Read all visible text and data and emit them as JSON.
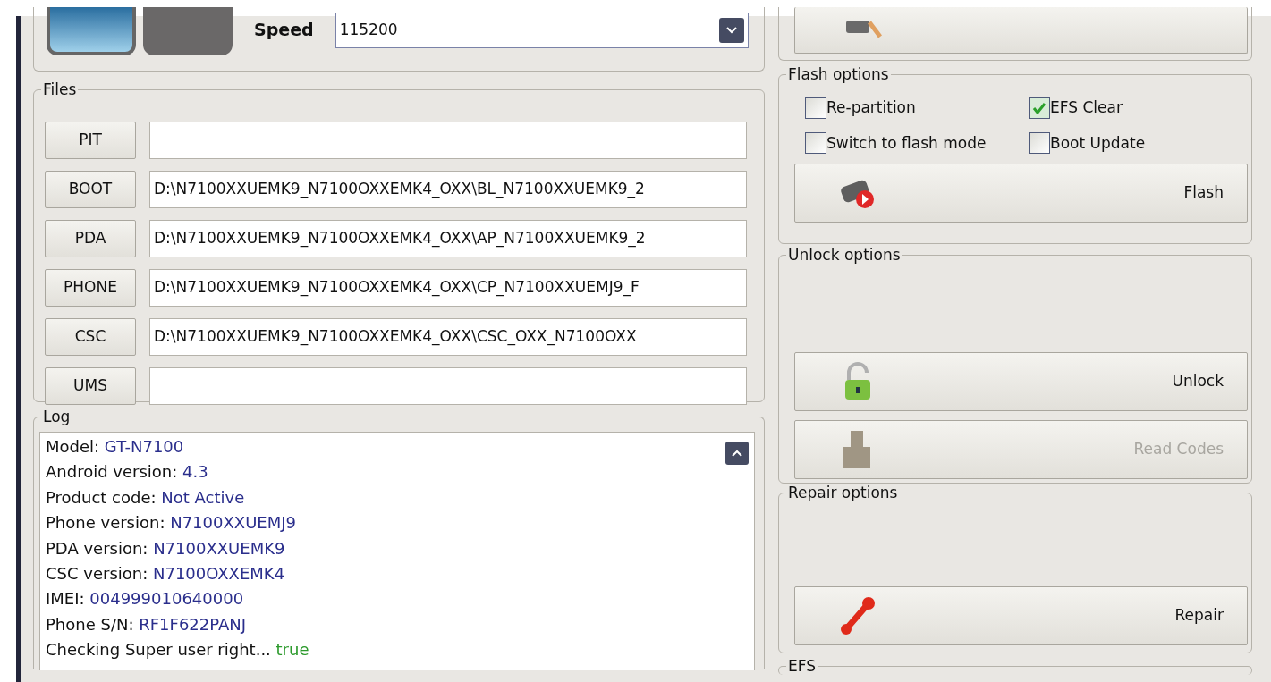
{
  "device": {
    "speed_label": "Speed",
    "speed_value": "115200"
  },
  "files": {
    "title": "Files",
    "rows": [
      {
        "label": "PIT"
      },
      {
        "label": "BOOT",
        "path": "D:\\N7100XXUEMK9_N7100OXXEMK4_OXX\\BL_N7100XXUEMK9_2"
      },
      {
        "label": "PDA",
        "path": "D:\\N7100XXUEMK9_N7100OXXEMK4_OXX\\AP_N7100XXUEMK9_2"
      },
      {
        "label": "PHONE",
        "path": "D:\\N7100XXUEMK9_N7100OXXEMK4_OXX\\CP_N7100XXUEMJ9_F"
      },
      {
        "label": "CSC",
        "path": "D:\\N7100XXUEMK9_N7100OXXEMK4_OXX\\CSC_OXX_N7100OXX"
      },
      {
        "label": "UMS"
      }
    ]
  },
  "log": {
    "title": "Log",
    "lines": [
      {
        "label": "Model: ",
        "value": "GT-N7100",
        "kind": "info"
      },
      {
        "label": "Android version: ",
        "value": "4.3",
        "kind": "info"
      },
      {
        "label": "Product code: ",
        "value": "Not Active",
        "kind": "info"
      },
      {
        "label": "Phone version: ",
        "value": "N7100XXUEMJ9",
        "kind": "info"
      },
      {
        "label": "PDA version: ",
        "value": "N7100XXUEMK9",
        "kind": "info"
      },
      {
        "label": "CSC version: ",
        "value": "N7100OXXEMK4",
        "kind": "info"
      },
      {
        "label": "IMEI: ",
        "value": "004999010640000",
        "kind": "info"
      },
      {
        "label": "Phone S/N: ",
        "value": "RF1F622PANJ",
        "kind": "info"
      },
      {
        "label": "Checking Super user right... ",
        "value": "true",
        "kind": "success"
      }
    ]
  },
  "flash_options": {
    "title": "Flash options",
    "checkboxes": [
      {
        "label": "Re-partition",
        "checked": false
      },
      {
        "label": "EFS Clear",
        "checked": true
      },
      {
        "label": "Switch to flash mode",
        "checked": false
      },
      {
        "label": "Boot Update",
        "checked": false
      }
    ],
    "button": {
      "label": "Flash"
    }
  },
  "unlock_options": {
    "title": "Unlock options",
    "buttons": [
      {
        "label": "Unlock",
        "kind": "unlock",
        "disabled": false
      },
      {
        "label": "Read Codes",
        "kind": "codes",
        "disabled": true
      }
    ]
  },
  "repair_options": {
    "title": "Repair options",
    "button": {
      "label": "Repair"
    }
  },
  "efs": {
    "title": "EFS"
  }
}
